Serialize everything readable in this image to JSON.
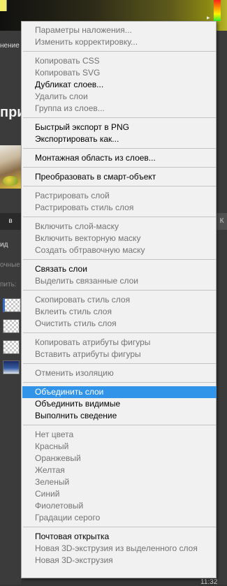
{
  "background": {
    "panel_tab_text": "нение",
    "title_fragment": "при",
    "layers_tab": "в",
    "other_tab": "К",
    "kind_label": "ид",
    "blend_mode_label": "очные",
    "lock_label": "пить:",
    "clock": "11:32"
  },
  "menu": {
    "groups": [
      {
        "items": [
          {
            "label": "Параметры наложения...",
            "disabled": true
          },
          {
            "label": "Изменить корректировку...",
            "disabled": true
          }
        ]
      },
      {
        "items": [
          {
            "label": "Копировать CSS",
            "disabled": true
          },
          {
            "label": "Копировать SVG",
            "disabled": true
          },
          {
            "label": "Дубликат слоев...",
            "disabled": false
          },
          {
            "label": "Удалить слои",
            "disabled": true
          },
          {
            "label": "Группа из слоев...",
            "disabled": true
          }
        ]
      },
      {
        "items": [
          {
            "label": "Быстрый экспорт в PNG",
            "disabled": false
          },
          {
            "label": "Экспортировать как...",
            "disabled": false
          }
        ]
      },
      {
        "items": [
          {
            "label": "Монтажная область из слоев...",
            "disabled": false
          }
        ]
      },
      {
        "items": [
          {
            "label": "Преобразовать в смарт-объект",
            "disabled": false
          }
        ]
      },
      {
        "items": [
          {
            "label": "Растрировать слой",
            "disabled": true
          },
          {
            "label": "Растрировать стиль слоя",
            "disabled": true
          }
        ]
      },
      {
        "items": [
          {
            "label": "Включить слой-маску",
            "disabled": true
          },
          {
            "label": "Включить векторную маску",
            "disabled": true
          },
          {
            "label": "Создать обтравочную маску",
            "disabled": true
          }
        ]
      },
      {
        "items": [
          {
            "label": "Связать слои",
            "disabled": false
          },
          {
            "label": "Выделить связанные слои",
            "disabled": true
          }
        ]
      },
      {
        "items": [
          {
            "label": "Скопировать стиль слоя",
            "disabled": true
          },
          {
            "label": "Вклеить стиль слоя",
            "disabled": true
          },
          {
            "label": "Очистить стиль слоя",
            "disabled": true
          }
        ]
      },
      {
        "items": [
          {
            "label": "Копировать атрибуты фигуры",
            "disabled": true
          },
          {
            "label": "Вставить атрибуты фигуры",
            "disabled": true
          }
        ]
      },
      {
        "items": [
          {
            "label": "Отменить изоляцию",
            "disabled": true
          }
        ]
      },
      {
        "items": [
          {
            "label": "Объединить слои",
            "disabled": false,
            "highlighted": true
          },
          {
            "label": "Объединить видимые",
            "disabled": false
          },
          {
            "label": "Выполнить сведение",
            "disabled": false
          }
        ]
      },
      {
        "items": [
          {
            "label": "Нет цвета",
            "disabled": true
          },
          {
            "label": "Красный",
            "disabled": true
          },
          {
            "label": "Оранжевый",
            "disabled": true
          },
          {
            "label": "Желтая",
            "disabled": true
          },
          {
            "label": "Зеленый",
            "disabled": true
          },
          {
            "label": "Синий",
            "disabled": true
          },
          {
            "label": "Фиолетовый",
            "disabled": true
          },
          {
            "label": "Градации серого",
            "disabled": true
          }
        ]
      },
      {
        "items": [
          {
            "label": "Почтовая открытка",
            "disabled": false
          },
          {
            "label": "Новая 3D-экструзия из выделенного слоя",
            "disabled": true
          },
          {
            "label": "Новая 3D-экструзия",
            "disabled": true
          }
        ]
      }
    ]
  }
}
